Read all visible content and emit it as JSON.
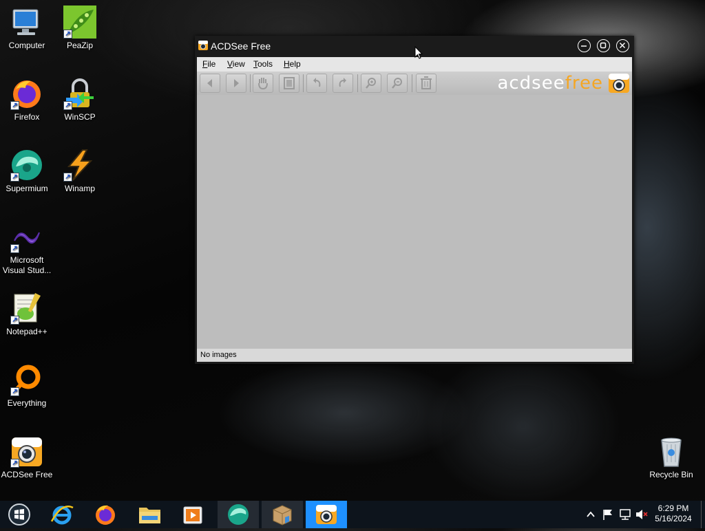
{
  "desktop": {
    "icons": [
      {
        "label": "Computer"
      },
      {
        "label": "PeaZip"
      },
      {
        "label": "Firefox"
      },
      {
        "label": "WinSCP"
      },
      {
        "label": "Supermium"
      },
      {
        "label": "Winamp"
      },
      {
        "label": "Microsoft Visual Stud..."
      },
      {
        "label": "Notepad++"
      },
      {
        "label": "Everything"
      },
      {
        "label": "ACDSee Free"
      },
      {
        "label": "Recycle Bin"
      }
    ]
  },
  "window": {
    "title": "ACDSee Free",
    "menu": [
      "File",
      "View",
      "Tools",
      "Help"
    ],
    "toolbar_buttons": [
      "back",
      "forward",
      "hand-tool",
      "fit-to-window",
      "rotate-left",
      "rotate-right",
      "zoom-in",
      "zoom-out",
      "delete"
    ],
    "logo": {
      "part1": "acdsee",
      "part2": "free"
    },
    "status": "No images",
    "colors": {
      "logo_orange": "#f5a623",
      "content_bg": "#bdbdbd"
    }
  },
  "taskbar": {
    "pinned": [
      "start",
      "internet-explorer",
      "firefox",
      "file-explorer",
      "media-player",
      "supermium",
      "package-installer",
      "acdsee-free"
    ],
    "active": "acdsee-free",
    "clock": {
      "time": "6:29 PM",
      "date": "5/16/2024"
    }
  }
}
